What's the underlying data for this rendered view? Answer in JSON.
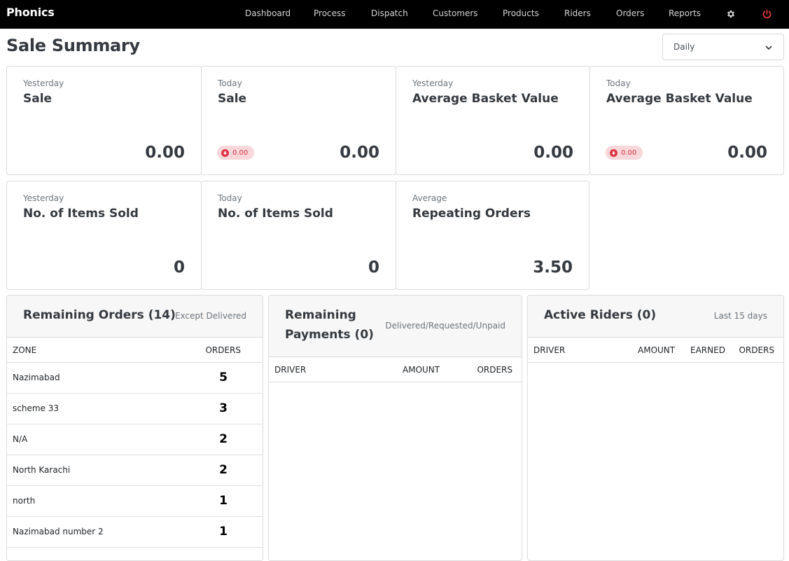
{
  "app": {
    "brand": "Phonics"
  },
  "nav": {
    "items": [
      "Dashboard",
      "Process",
      "Dispatch",
      "Customers",
      "Products",
      "Riders",
      "Orders",
      "Reports"
    ],
    "icons": [
      "gear-icon",
      "power-icon"
    ],
    "power_color": "#e53935"
  },
  "page": {
    "title": "Sale Summary"
  },
  "period": {
    "selected": "Daily"
  },
  "stats": [
    {
      "caption": "Yesterday",
      "title": "Sale",
      "value": "0.00",
      "change": ""
    },
    {
      "caption": "Today",
      "title": "Sale",
      "value": "0.00",
      "change": "0.00"
    },
    {
      "caption": "Yesterday",
      "title": "Average Basket Value",
      "value": "0.00",
      "change": ""
    },
    {
      "caption": "Today",
      "title": "Average Basket Value",
      "value": "0.00",
      "change": "0.00"
    },
    {
      "caption": "Yesterday",
      "title": "No. of Items Sold",
      "value": "0",
      "change": ""
    },
    {
      "caption": "Today",
      "title": "No. of Items Sold",
      "value": "0",
      "change": ""
    },
    {
      "caption": "Average",
      "title": "Repeating Orders",
      "value": "3.50",
      "change": ""
    }
  ],
  "remaining_orders": {
    "title": "Remaining Orders (14)",
    "note": "Except Delivered",
    "columns": [
      "ZONE",
      "ORDERS"
    ],
    "rows": [
      {
        "zone": "Nazimabad",
        "orders": "5"
      },
      {
        "zone": "scheme 33",
        "orders": "3"
      },
      {
        "zone": "N/A",
        "orders": "2"
      },
      {
        "zone": "North Karachi",
        "orders": "2"
      },
      {
        "zone": "north",
        "orders": "1"
      },
      {
        "zone": "Nazimabad number 2",
        "orders": "1"
      }
    ]
  },
  "remaining_payments": {
    "title_line1": "Remaining",
    "title_line2": "Payments (0)",
    "note": "Delivered/Requested/Unpaid",
    "columns": [
      "DRIVER",
      "AMOUNT",
      "ORDERS"
    ]
  },
  "active_riders": {
    "title": "Active Riders (0)",
    "note": "Last 15 days",
    "columns": [
      "DRIVER",
      "AMOUNT",
      "EARNED",
      "ORDERS"
    ]
  }
}
